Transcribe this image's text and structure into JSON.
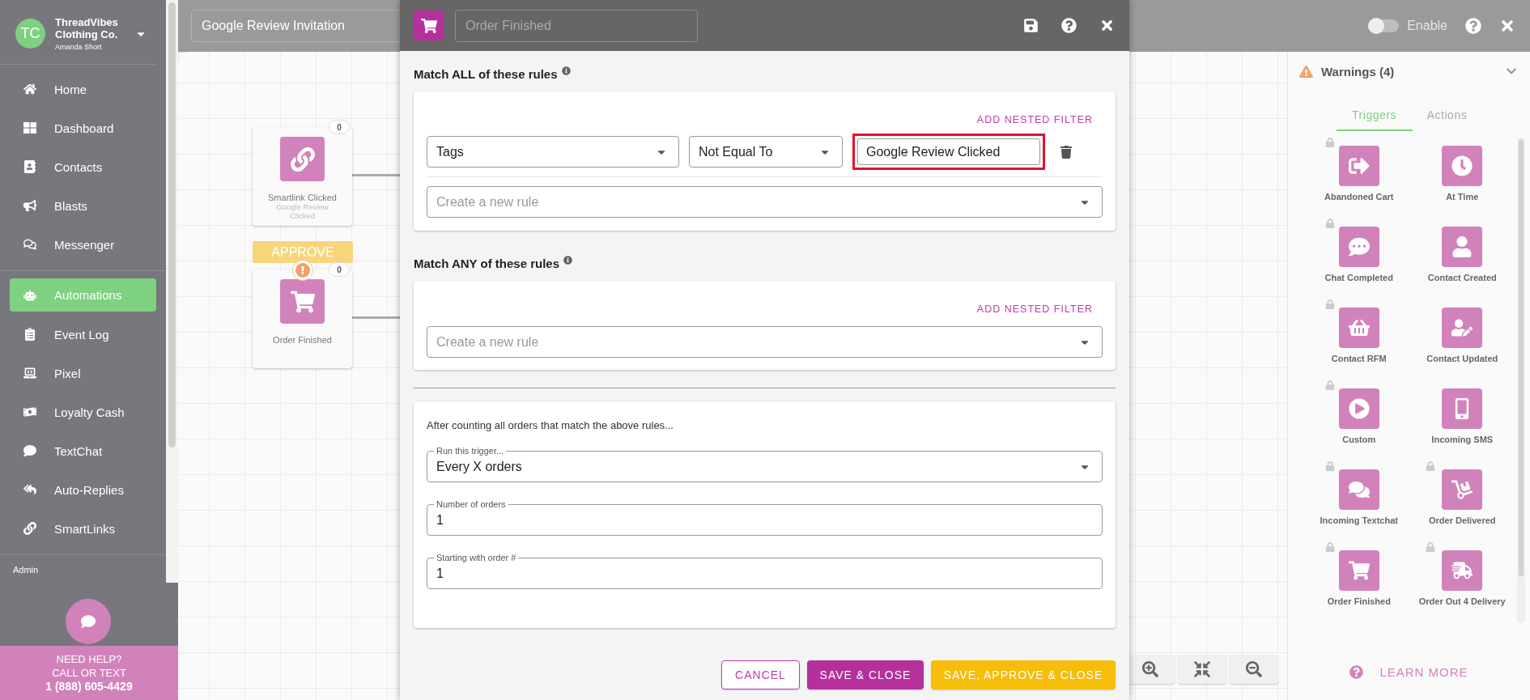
{
  "sidebar": {
    "account": {
      "initials": "TC",
      "name": "ThreadVibes Clothing Co.",
      "user": "Amanda Short"
    },
    "nav_groups": [
      [
        {
          "label": "Home",
          "selected": false
        },
        {
          "label": "Dashboard",
          "selected": false
        },
        {
          "label": "Contacts",
          "selected": false
        },
        {
          "label": "Blasts",
          "selected": false
        },
        {
          "label": "Messenger",
          "selected": false
        }
      ],
      [
        {
          "label": "Automations",
          "selected": true
        },
        {
          "label": "Event Log",
          "selected": false
        },
        {
          "label": "Pixel",
          "selected": false
        },
        {
          "label": "Loyalty Cash",
          "selected": false
        },
        {
          "label": "TextChat",
          "selected": false
        },
        {
          "label": "Auto-Replies",
          "selected": false
        },
        {
          "label": "SmartLinks",
          "selected": false
        }
      ]
    ],
    "section_label": "Admin",
    "help": {
      "line_1": "NEED HELP?",
      "line_2": "CALL OR TEXT",
      "phone": "1 (888) 605-4429"
    }
  },
  "topbar": {
    "automation_name": "Google Review Invitation",
    "enable": {
      "label": "Enable",
      "on": false
    }
  },
  "canvas": {
    "nodes": [
      {
        "kind": "smartlink",
        "title": "Smartlink Clicked",
        "subtitle": "Google Review Clicked",
        "count": "0",
        "warning": false
      },
      {
        "kind": "order",
        "title": "Order Finished",
        "count": "0",
        "banner": "APPROVE",
        "warning": true
      }
    ]
  },
  "modal": {
    "title_placeholder": "Order Finished",
    "all_rules": {
      "heading": "Match ALL of these rules",
      "add_nested": "ADD NESTED FILTER",
      "rules": [
        {
          "field": "Tags",
          "operator": "Not Equal To",
          "value": "Google Review Clicked",
          "highlighted": true
        }
      ],
      "new_rule_placeholder": "Create a new rule"
    },
    "any_rules": {
      "heading": "Match ANY of these rules",
      "add_nested": "ADD NESTED FILTER",
      "new_rule_placeholder": "Create a new rule"
    },
    "counting": {
      "intro": "After counting all orders that match the above rules...",
      "fields": [
        {
          "kind": "select",
          "label": "Run this trigger...",
          "value": "Every X orders"
        },
        {
          "kind": "input",
          "label": "Number of orders",
          "value": "1"
        },
        {
          "kind": "input",
          "label": "Starting with order #",
          "value": "1"
        }
      ]
    },
    "buttons": [
      {
        "kind": "outline",
        "label": "CANCEL"
      },
      {
        "kind": "primary",
        "label": "SAVE & CLOSE"
      },
      {
        "kind": "approve",
        "label": "SAVE, APPROVE & CLOSE"
      }
    ]
  },
  "panel": {
    "warnings": {
      "label": "Warnings (4)",
      "expanded": false
    },
    "tabs": [
      {
        "label": "Triggers",
        "selected": true
      },
      {
        "label": "Actions",
        "selected": false
      }
    ],
    "triggers": [
      {
        "label": "Abandoned Cart",
        "locked": true
      },
      {
        "label": "At Time",
        "locked": false
      },
      {
        "label": "Chat Completed",
        "locked": true
      },
      {
        "label": "Contact Created",
        "locked": false
      },
      {
        "label": "Contact RFM",
        "locked": true
      },
      {
        "label": "Contact Updated",
        "locked": false
      },
      {
        "label": "Custom",
        "locked": true
      },
      {
        "label": "Incoming SMS",
        "locked": false
      },
      {
        "label": "Incoming Textchat",
        "locked": true
      },
      {
        "label": "Order Delivered",
        "locked": true
      },
      {
        "label": "Order Finished",
        "locked": true
      },
      {
        "label": "Order Out 4 Delivery",
        "locked": true
      }
    ],
    "learn_more": "LEARN MORE"
  }
}
